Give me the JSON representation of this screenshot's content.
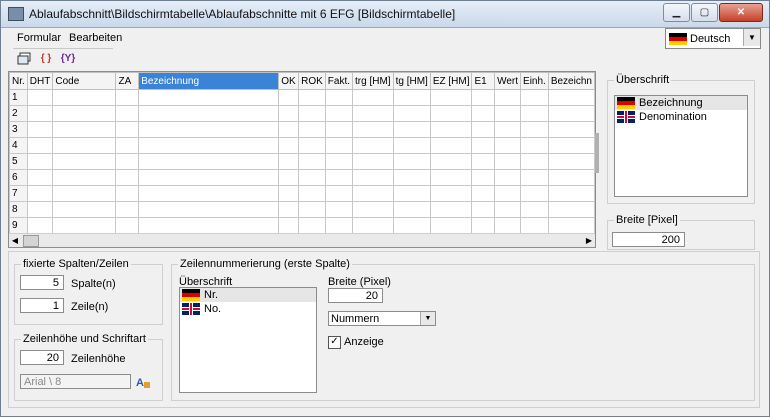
{
  "window": {
    "title": "Ablaufabschnitt\\Bildschirmtabelle\\Ablaufabschnitte mit 6 EFG [Bildschirmtabelle]",
    "buttons": [
      "minimize-icon",
      "maximize-icon",
      "close-icon"
    ]
  },
  "menu": {
    "formular": "Formular",
    "bearbeiten": "Bearbeiten"
  },
  "toolbar": {
    "icons": [
      "form-icon",
      "braces-icon",
      "y-braces-icon"
    ],
    "braces": "{ }",
    "ybraces": "{Y}"
  },
  "language": {
    "selected": "Deutsch"
  },
  "grid": {
    "columns": [
      "Nr.",
      "DHT",
      "Code",
      "ZA",
      "Bezeichnung",
      "OK",
      "ROK",
      "Fakt.",
      "trg [HM]",
      "tg [HM]",
      "EZ [HM]",
      "E1",
      "Wert",
      "Einh.",
      "Bezeichn"
    ],
    "selected_column": "Bezeichnung",
    "rows": [
      "1",
      "2",
      "3",
      "4",
      "5",
      "6",
      "7",
      "8",
      "9"
    ]
  },
  "ueberschrift": {
    "legend": "Überschrift",
    "items": [
      {
        "flag": "de",
        "label": "Bezeichnung"
      },
      {
        "flag": "uk",
        "label": "Denomination"
      }
    ]
  },
  "breite": {
    "legend": "Breite [Pixel]",
    "value": "200"
  },
  "fixierte": {
    "legend": "fixierte Spalten/Zeilen",
    "spalten_value": "5",
    "spalten_label": "Spalte(n)",
    "zeilen_value": "1",
    "zeilen_label": "Zeile(n)"
  },
  "zeilenhoehe": {
    "legend": "Zeilenhöhe und Schriftart",
    "value": "20",
    "label": "Zeilenhöhe",
    "font": "Arial \\ 8"
  },
  "zeilennummerierung": {
    "legend": "Zeilennummerierung (erste Spalte)",
    "ueberschrift_label": "Überschrift",
    "items": [
      {
        "flag": "de",
        "label": "Nr."
      },
      {
        "flag": "uk",
        "label": "No."
      }
    ],
    "breite_label": "Breite (Pixel)",
    "breite_value": "20",
    "format": "Nummern",
    "anzeige_label": "Anzeige",
    "anzeige_checked": "✓"
  }
}
